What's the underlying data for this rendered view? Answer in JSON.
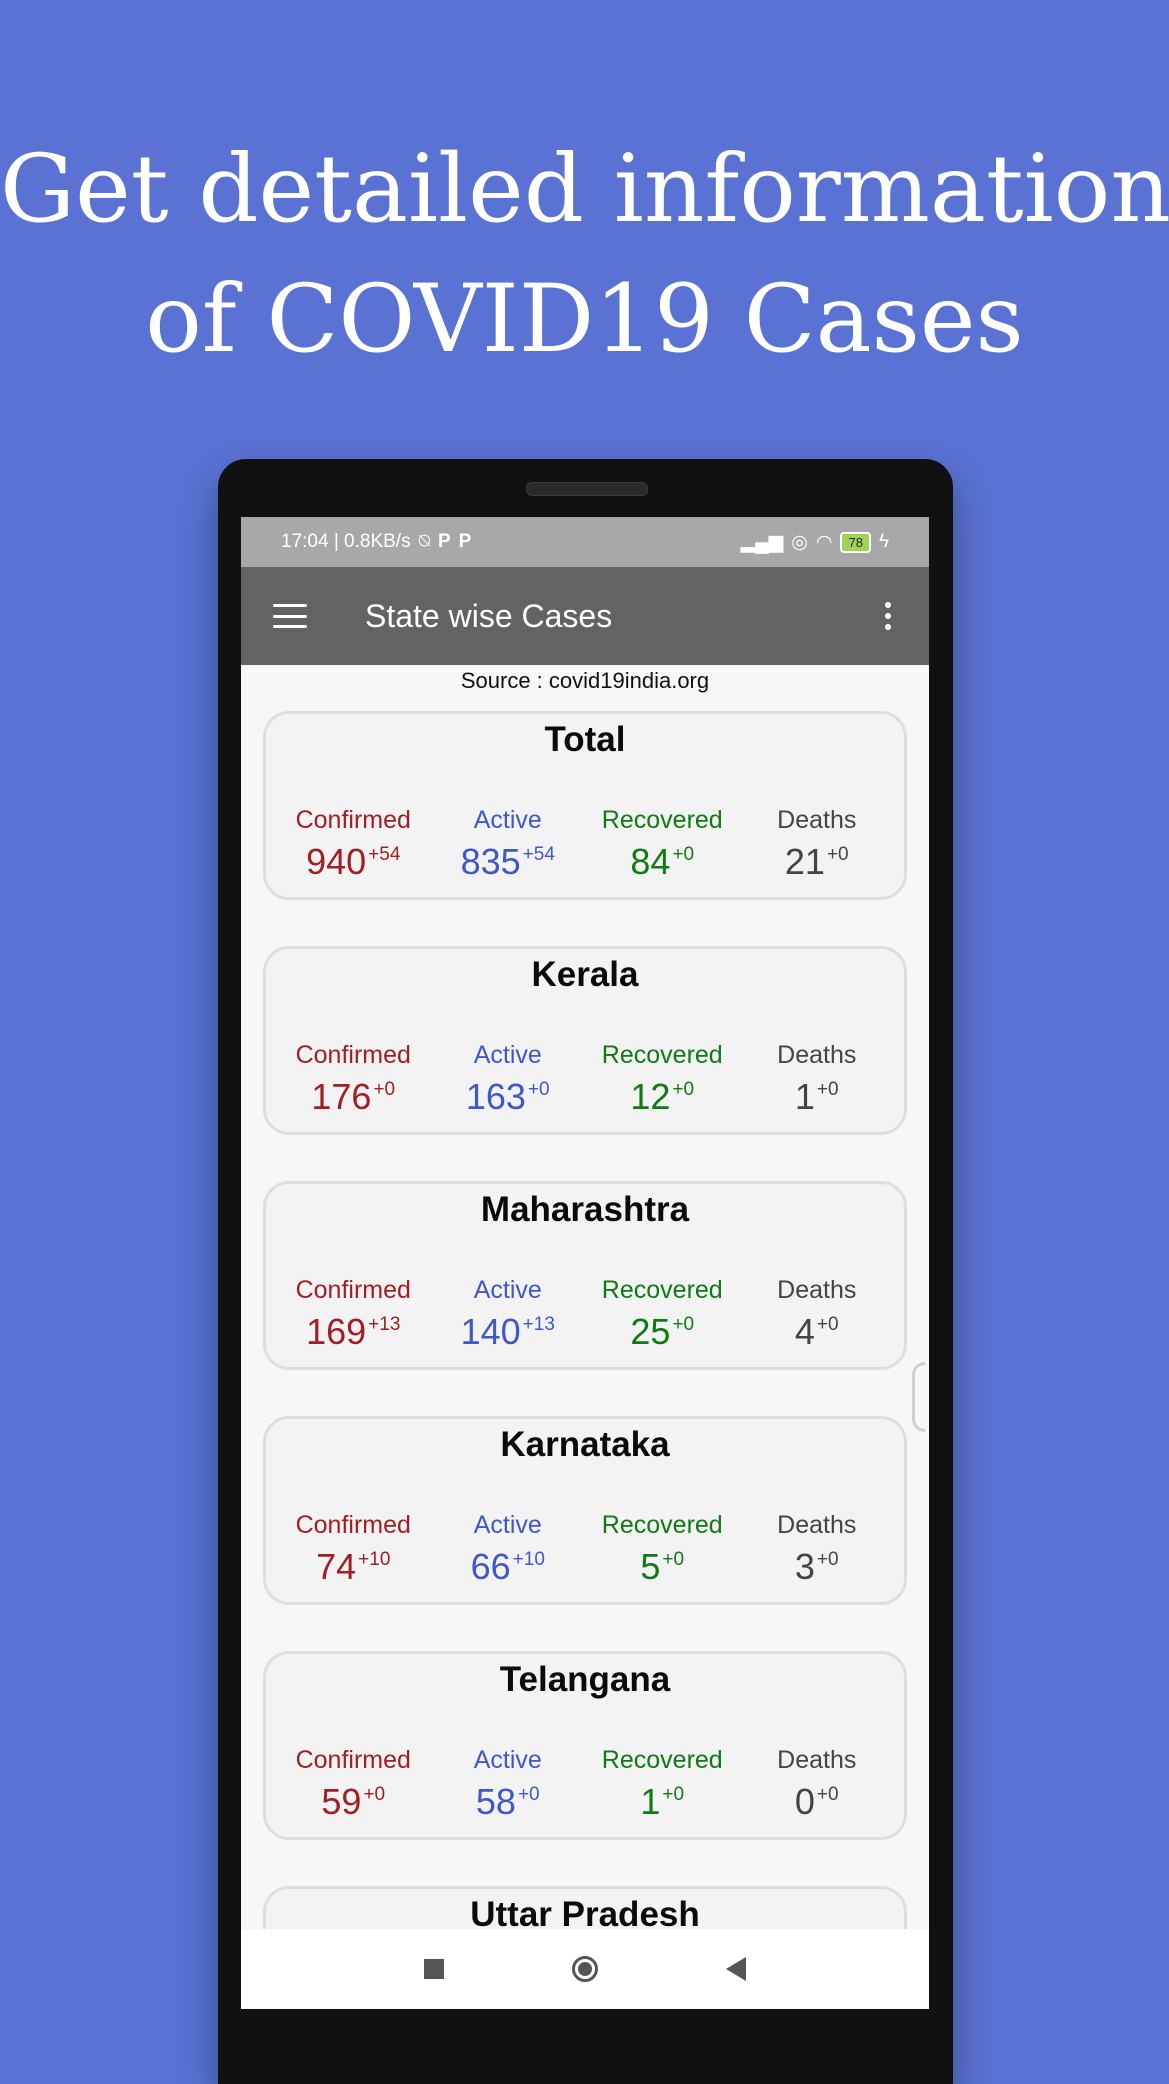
{
  "headline": {
    "line1": "Get detailed information",
    "line2": "of COVID19 Cases"
  },
  "status_bar": {
    "time_speed": "17:04 | 0.8KB/s",
    "battery": "78"
  },
  "app_bar": {
    "title": "State wise Cases"
  },
  "source": "Source : covid19india.org",
  "labels": {
    "confirmed": "Confirmed",
    "active": "Active",
    "recovered": "Recovered",
    "deaths": "Deaths"
  },
  "cards": [
    {
      "name": "Total",
      "confirmed": "940",
      "confirmed_delta": "+54",
      "active": "835",
      "active_delta": "+54",
      "recovered": "84",
      "recovered_delta": "+0",
      "deaths": "21",
      "deaths_delta": "+0"
    },
    {
      "name": "Kerala",
      "confirmed": "176",
      "confirmed_delta": "+0",
      "active": "163",
      "active_delta": "+0",
      "recovered": "12",
      "recovered_delta": "+0",
      "deaths": "1",
      "deaths_delta": "+0"
    },
    {
      "name": "Maharashtra",
      "confirmed": "169",
      "confirmed_delta": "+13",
      "active": "140",
      "active_delta": "+13",
      "recovered": "25",
      "recovered_delta": "+0",
      "deaths": "4",
      "deaths_delta": "+0"
    },
    {
      "name": "Karnataka",
      "confirmed": "74",
      "confirmed_delta": "+10",
      "active": "66",
      "active_delta": "+10",
      "recovered": "5",
      "recovered_delta": "+0",
      "deaths": "3",
      "deaths_delta": "+0"
    },
    {
      "name": "Telangana",
      "confirmed": "59",
      "confirmed_delta": "+0",
      "active": "58",
      "active_delta": "+0",
      "recovered": "1",
      "recovered_delta": "+0",
      "deaths": "0",
      "deaths_delta": "+0"
    },
    {
      "name": "Uttar Pradesh"
    }
  ],
  "colors": {
    "background": "#5a72d3",
    "confirmed": "#a21e24",
    "active": "#3f57cc",
    "recovered": "#107a14",
    "deaths": "#444444",
    "app_bar": "#636363"
  }
}
